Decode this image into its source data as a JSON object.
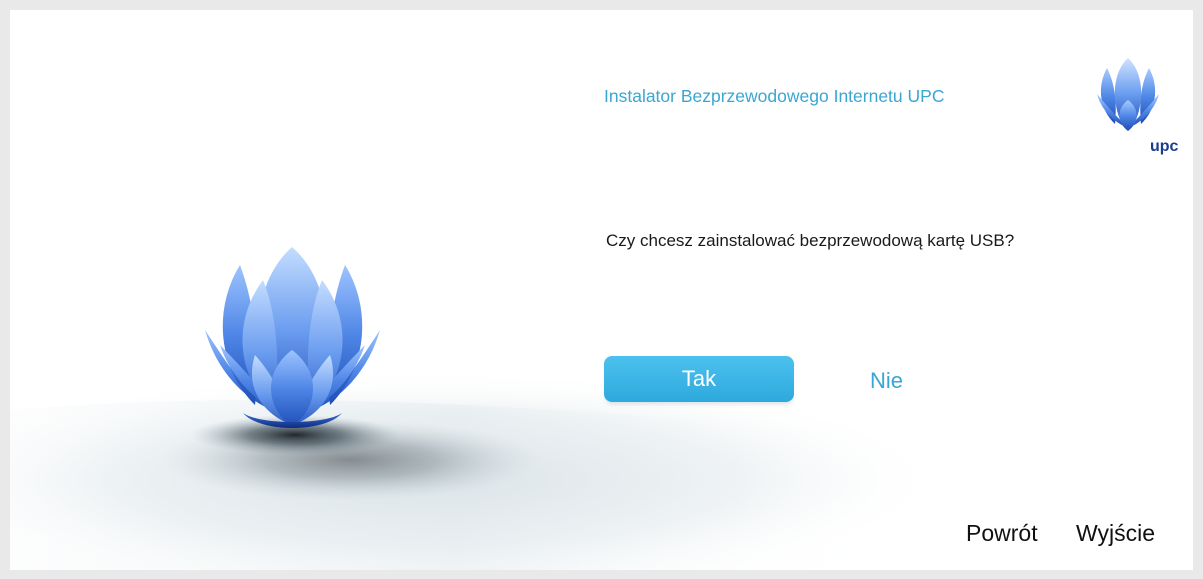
{
  "app": {
    "title": "Instalator Bezprzewodowego Internetu UPC",
    "brand_text": "upc"
  },
  "icons": {
    "hero": "upc-lotus-logo-icon",
    "brand": "upc-brand-logo-icon"
  },
  "prompt": {
    "question": "Czy chcesz zainstalować bezprzewodową kartę USB?"
  },
  "actions": {
    "yes_label": "Tak",
    "no_label": "Nie"
  },
  "nav": {
    "back_label": "Powrót",
    "exit_label": "Wyjście"
  },
  "colors": {
    "accent": "#3aa6d2",
    "button": "#35b0e2",
    "brand_dark": "#1b3e8a"
  }
}
